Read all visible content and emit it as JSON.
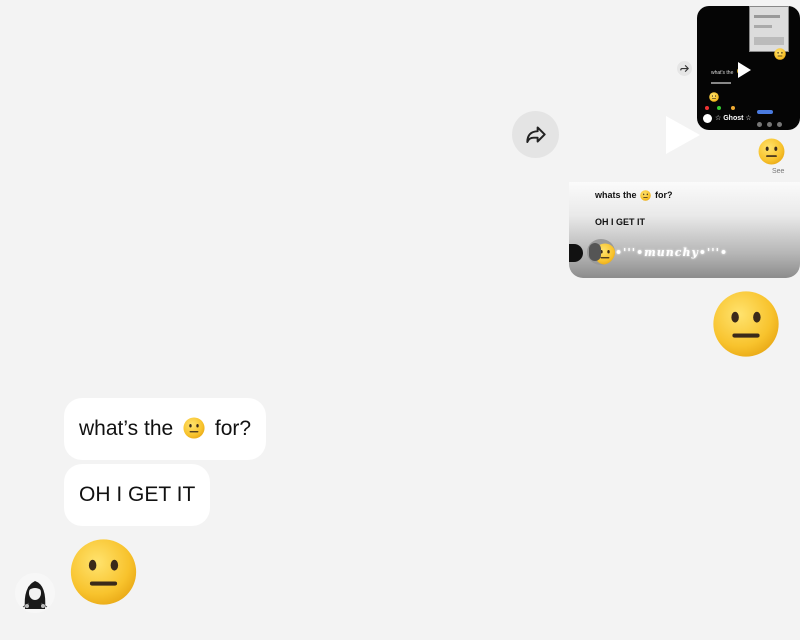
{
  "outgoing": {
    "reel": {
      "caption_line": "what's the",
      "username": "☆ Ghost ☆"
    },
    "see_label": "See",
    "reply_preview": {
      "line1_prefix": "whats the",
      "line1_suffix": "for?",
      "line2": "OH I GET IT",
      "name_overlay": "•'''•munchy•'''•"
    }
  },
  "incoming": {
    "messages": [
      {
        "prefix": "what’s the",
        "suffix": "for?"
      },
      {
        "text": "OH I GET IT"
      }
    ]
  },
  "icons": {
    "share": "share-arrow-icon",
    "reaction": "neutral-face-emoji"
  },
  "colors": {
    "background": "#f3f3f3",
    "bubble": "#ffffff",
    "emoji_yellow": "#f7c531"
  }
}
